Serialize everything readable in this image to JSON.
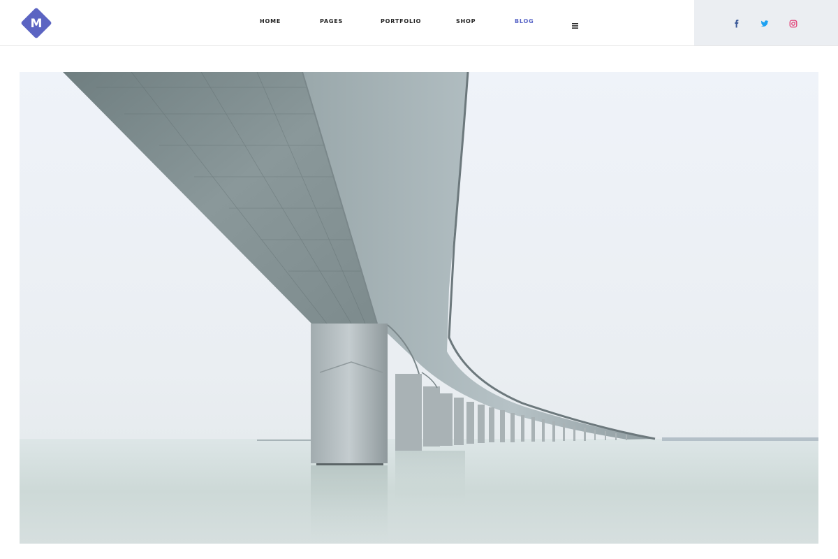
{
  "brand": {
    "logo_letter": "M",
    "accent": "#5b64c2"
  },
  "nav": {
    "items": [
      {
        "label": "HOME",
        "active": false
      },
      {
        "label": "PAGES",
        "active": false
      },
      {
        "label": "PORTFOLIO",
        "active": false
      },
      {
        "label": "SHOP",
        "active": false
      },
      {
        "label": "BLOG",
        "active": true
      }
    ],
    "menu_icon": "hamburger-icon",
    "active_color": "#5663c6"
  },
  "social": {
    "icons": [
      "facebook-icon",
      "twitter-icon",
      "instagram-icon"
    ],
    "colors": {
      "facebook": "#3b5998",
      "twitter": "#1da1f2",
      "instagram": "#e1306c"
    }
  },
  "hero": {
    "subject": "bridge-photo"
  }
}
